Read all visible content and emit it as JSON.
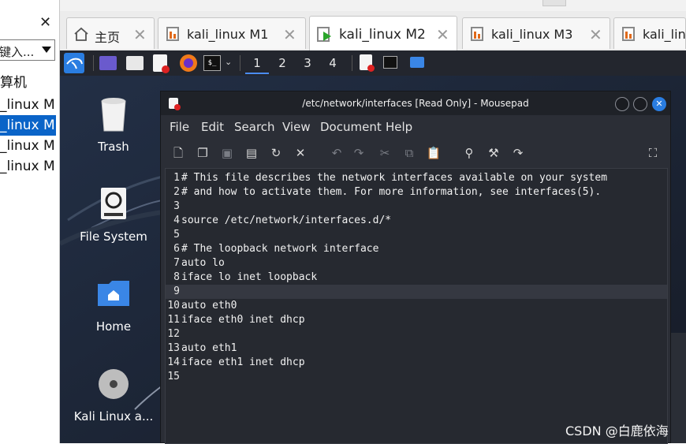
{
  "library": {
    "search_text": "键入...",
    "items": [
      {
        "label": "算机"
      },
      {
        "label": "_linux M"
      },
      {
        "label": "_linux M"
      },
      {
        "label": "_linux M"
      },
      {
        "label": "_linux M"
      }
    ]
  },
  "tabs": [
    {
      "label": "主页"
    },
    {
      "label": "kali_linux M1"
    },
    {
      "label": "kali_linux M2"
    },
    {
      "label": "kali_linux M3"
    },
    {
      "label": "kali_linu"
    }
  ],
  "panel": {
    "workspaces": [
      "1",
      "2",
      "3",
      "4"
    ],
    "active_workspace": "1",
    "terminal_glyph": "$_"
  },
  "desktop_icons": [
    {
      "label": "Trash"
    },
    {
      "label": "File System"
    },
    {
      "label": "Home"
    },
    {
      "label": "Kali Linux a..."
    }
  ],
  "mousepad": {
    "title": "/etc/network/interfaces [Read Only] - Mousepad",
    "menu": [
      "File",
      "Edit",
      "Search",
      "View",
      "Document",
      "Help"
    ],
    "lines": [
      {
        "n": "1",
        "text": "# This file describes the network interfaces available on your system"
      },
      {
        "n": "2",
        "text": "# and how to activate them. For more information, see interfaces(5)."
      },
      {
        "n": "3",
        "text": ""
      },
      {
        "n": "4",
        "text": "source /etc/network/interfaces.d/*"
      },
      {
        "n": "5",
        "text": ""
      },
      {
        "n": "6",
        "text": "# The loopback network interface"
      },
      {
        "n": "7",
        "text": "auto lo"
      },
      {
        "n": "8",
        "text": "iface lo inet loopback"
      },
      {
        "n": "9",
        "text": ""
      },
      {
        "n": "10",
        "text": "auto eth0"
      },
      {
        "n": "11",
        "text": "iface eth0 inet dhcp"
      },
      {
        "n": "12",
        "text": ""
      },
      {
        "n": "13",
        "text": "auto eth1"
      },
      {
        "n": "14",
        "text": "iface eth1 inet dhcp"
      },
      {
        "n": "15",
        "text": ""
      }
    ],
    "current_line": "9"
  },
  "watermark": "CSDN @白鹿依海",
  "colors": {
    "accent": "#0a64c8",
    "close_button": "#2a7de1",
    "panel": "#23262e",
    "window": "#2b2e36"
  }
}
